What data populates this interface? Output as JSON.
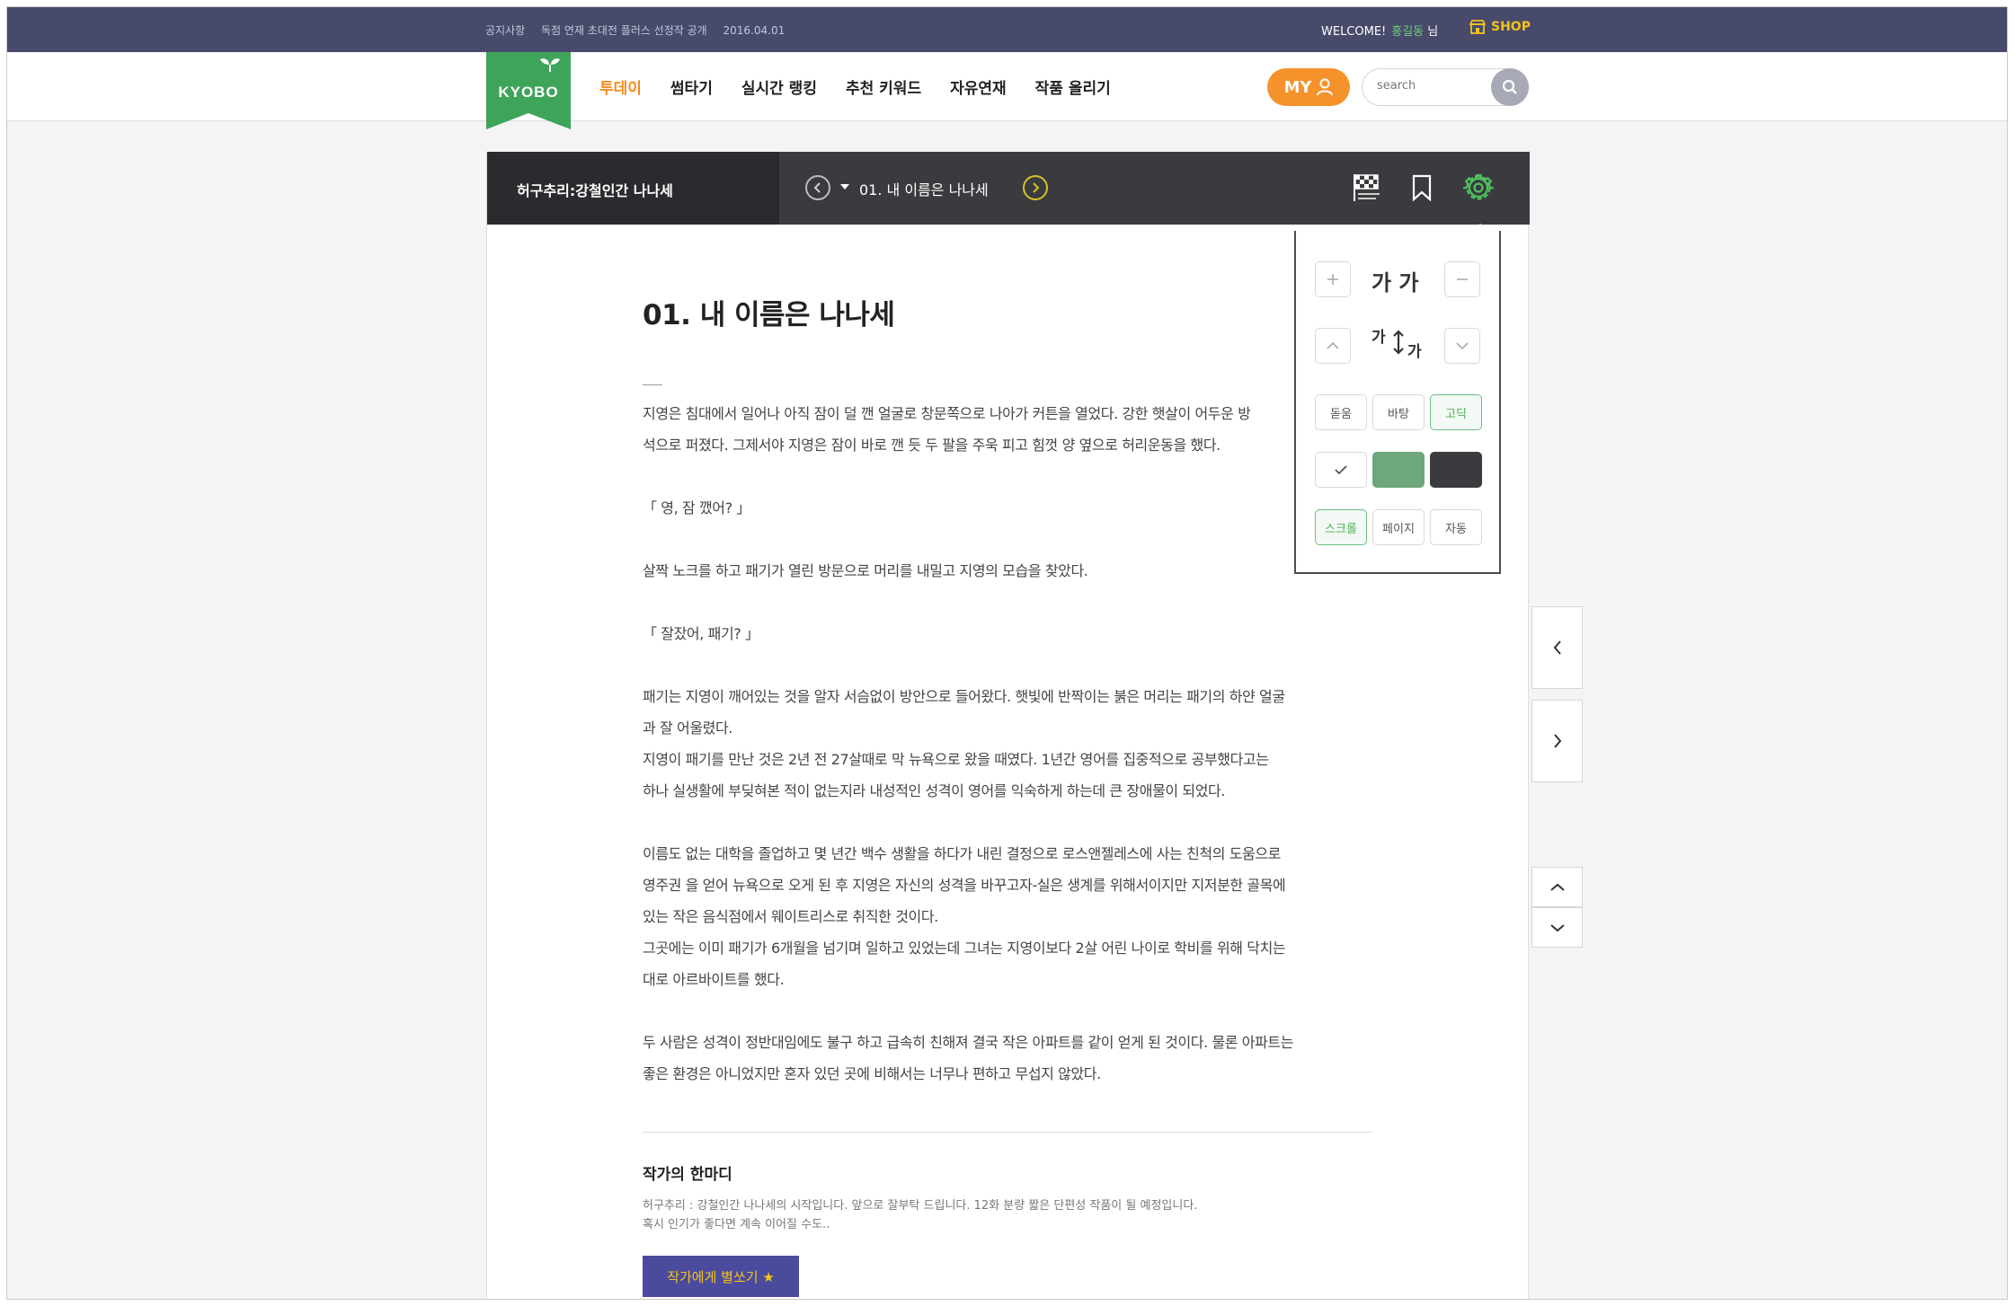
{
  "topbar": {
    "notices": [
      "공지사항",
      "독점 연재 초대전 플러스 선정작 공개",
      "2016.04.01"
    ],
    "welcome": "WELCOME!",
    "user_name": "홍길동",
    "user_suffix": "님",
    "shop_label": "SHOP"
  },
  "header": {
    "logo_text": "KYOBO",
    "nav": [
      "투데이",
      "썸타기",
      "실시간 랭킹",
      "추천 키워드",
      "자유연재",
      "작품 올리기"
    ],
    "active_nav": "투데이",
    "my_label": "MY",
    "search_placeholder": "search"
  },
  "reader_bar": {
    "work_title": "허구추리:강철인간 나나세",
    "episode_title": "01. 내 이름은 나나세",
    "icons": [
      "checkered-flag-icon",
      "bookmark-icon",
      "gear-icon"
    ]
  },
  "content": {
    "chapter_title": "01. 내 이름은 나나세",
    "lines": [
      "지영은 침대에서 일어나 아직 잠이 덜 깬 얼굴로 창문쪽으로 나아가 커튼을 열었다. 강한 햇살이 어두운 방",
      "석으로 퍼졌다. 그제서야 지영은 잠이 바로 깬 듯 두 팔을 주욱 피고 힘껏 양 옆으로 허리운동을 했다.",
      "「 영, 잠 깼어? 」",
      "살짝 노크를 하고 패기가 열린 방문으로 머리를 내밀고 지영의 모습을 찾았다.",
      "「 잘잤어, 패기? 」",
      "패기는 지영이 깨어있는 것을 알자 서슴없이 방안으로 들어왔다. 햇빛에 반짝이는 붉은 머리는 패기의 하얀 얼굴",
      "과 잘 어울렸다.",
      "지영이 패기를 만난 것은 2년 전 27살때로 막 뉴욕으로 왔을 때였다. 1년간 영어를 집중적으로 공부했다고는",
      "하나 실생활에 부딪혀본 적이 없는지라 내성적인 성격이 영어를 익숙하게 하는데 큰 장애물이 되었다.",
      "이름도 없는 대학을 졸업하고 몇 년간 백수 생활을 하다가 내린 결정으로 로스앤젤레스에 사는 친척의 도움으로",
      "영주권 을 얻어 뉴욕으로 오게 된 후 지영은 자신의 성격을 바꾸고자-실은 생계를 위해서이지만 지저분한 골목에",
      "있는 작은 음식점에서 웨이트리스로 취직한 것이다.",
      "그곳에는 이미 패기가 6개월을 넘기며 일하고 있었는데 그녀는 지영이보다 2살 어린 나이로 학비를 위해 닥치는",
      "대로 아르바이트를 했다.",
      "두 사람은 성격이 정반대임에도 불구 하고 급속히 친해져 결국 작은 아파트를 같이 얻게 된 것이다. 물론 아파트는",
      "좋은 환경은 아니었지만 혼자 있던 곳에 비해서는 너무나 편하고 무섭지 않았다."
    ],
    "author_heading": "작가의 한마디",
    "author_notes": [
      "허구추리 : 강철인간 나나세의 시작입니다. 앞으로 잘부탁 드립니다. 12화 분량 짧은 단편성 작품이 될 예정입니다.",
      "혹시 인기가 좋다면 계속 이어질 수도.."
    ],
    "star_button": "작가에게 별쏘기 ★"
  },
  "settings": {
    "font_size_label": "가 가",
    "line_height_big": "가",
    "line_height_small": "가",
    "fonts": [
      "돋움",
      "바탕",
      "고딕"
    ],
    "selected_font": "고딕",
    "themes": [
      {
        "name": "white",
        "color": "#ffffff"
      },
      {
        "name": "green",
        "color": "#6ea77b"
      },
      {
        "name": "dark",
        "color": "#3a3b3e"
      }
    ],
    "view_modes": [
      "스크롤",
      "페이지",
      "자동"
    ],
    "selected_view_mode": "스크롤"
  },
  "colors": {
    "topbar": "#474a6b",
    "accent_orange": "#f6922b",
    "brand_green": "#3ea45a",
    "reader_bar": "#3a3b3e",
    "star_button": "#4b4b9d"
  }
}
